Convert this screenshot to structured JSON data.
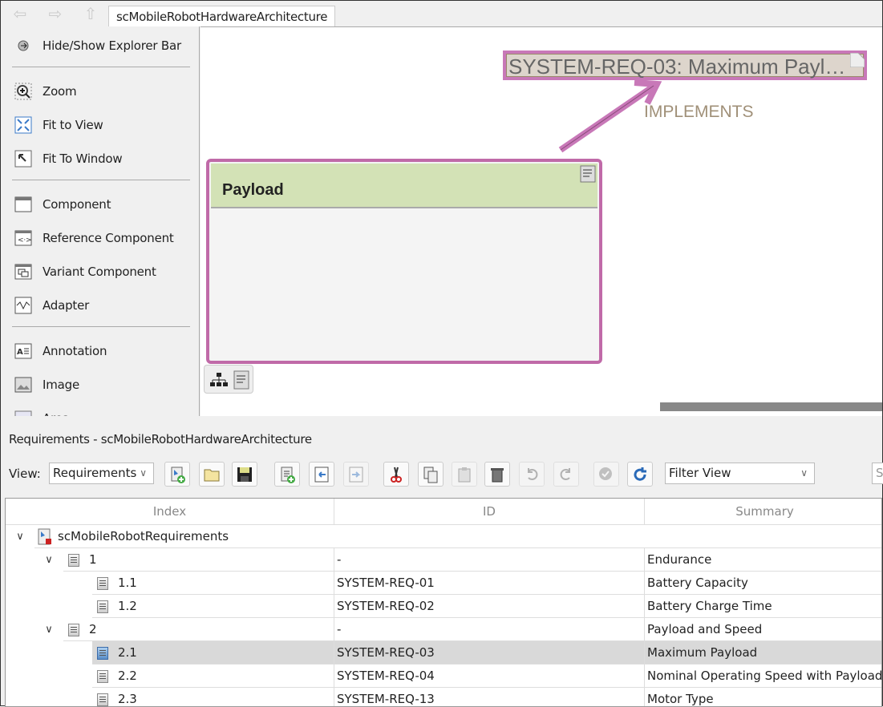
{
  "window": {
    "tab": "scMobileRobotHardwareArchitecture"
  },
  "palette": {
    "items": [
      {
        "label": "Hide/Show Explorer Bar",
        "icon": "explorer-toggle-icon"
      },
      {
        "label": "Zoom",
        "icon": "zoom-icon"
      },
      {
        "label": "Fit to View",
        "icon": "fit-to-view-icon"
      },
      {
        "label": "Fit To Window",
        "icon": "fit-to-window-icon"
      },
      {
        "label": "Component",
        "icon": "component-icon"
      },
      {
        "label": "Reference Component",
        "icon": "reference-component-icon"
      },
      {
        "label": "Variant Component",
        "icon": "variant-component-icon"
      },
      {
        "label": "Adapter",
        "icon": "adapter-icon"
      },
      {
        "label": "Annotation",
        "icon": "annotation-icon"
      },
      {
        "label": "Image",
        "icon": "image-icon"
      },
      {
        "label": "Area",
        "icon": "area-icon"
      }
    ]
  },
  "canvas": {
    "note": "SYSTEM-REQ-03: Maximum Payl…",
    "link_label": "IMPLEMENTS",
    "block_title": "Payload",
    "highlight_color": "#c06aa8",
    "block_header_color": "#d3e2b6"
  },
  "requirements": {
    "title": "Requirements - scMobileRobotHardwareArchitecture",
    "view_label": "View:",
    "view_value": "Requirements",
    "filter_value": "Filter View",
    "search_stub": "S",
    "columns": [
      "Index",
      "ID",
      "Summary"
    ],
    "root": "scMobileRobotRequirements",
    "rows": [
      {
        "index": "1",
        "id": "-",
        "summary": "Endurance",
        "level": 1
      },
      {
        "index": "1.1",
        "id": "SYSTEM-REQ-01",
        "summary": "Battery Capacity",
        "level": 2
      },
      {
        "index": "1.2",
        "id": "SYSTEM-REQ-02",
        "summary": "Battery Charge Time",
        "level": 2
      },
      {
        "index": "2",
        "id": "-",
        "summary": "Payload and Speed",
        "level": 1
      },
      {
        "index": "2.1",
        "id": "SYSTEM-REQ-03",
        "summary": "Maximum Payload",
        "level": 2,
        "selected": true
      },
      {
        "index": "2.2",
        "id": "SYSTEM-REQ-04",
        "summary": "Nominal Operating Speed with Payload",
        "level": 2
      },
      {
        "index": "2.3",
        "id": "SYSTEM-REQ-13",
        "summary": "Motor Type",
        "level": 2
      }
    ]
  }
}
